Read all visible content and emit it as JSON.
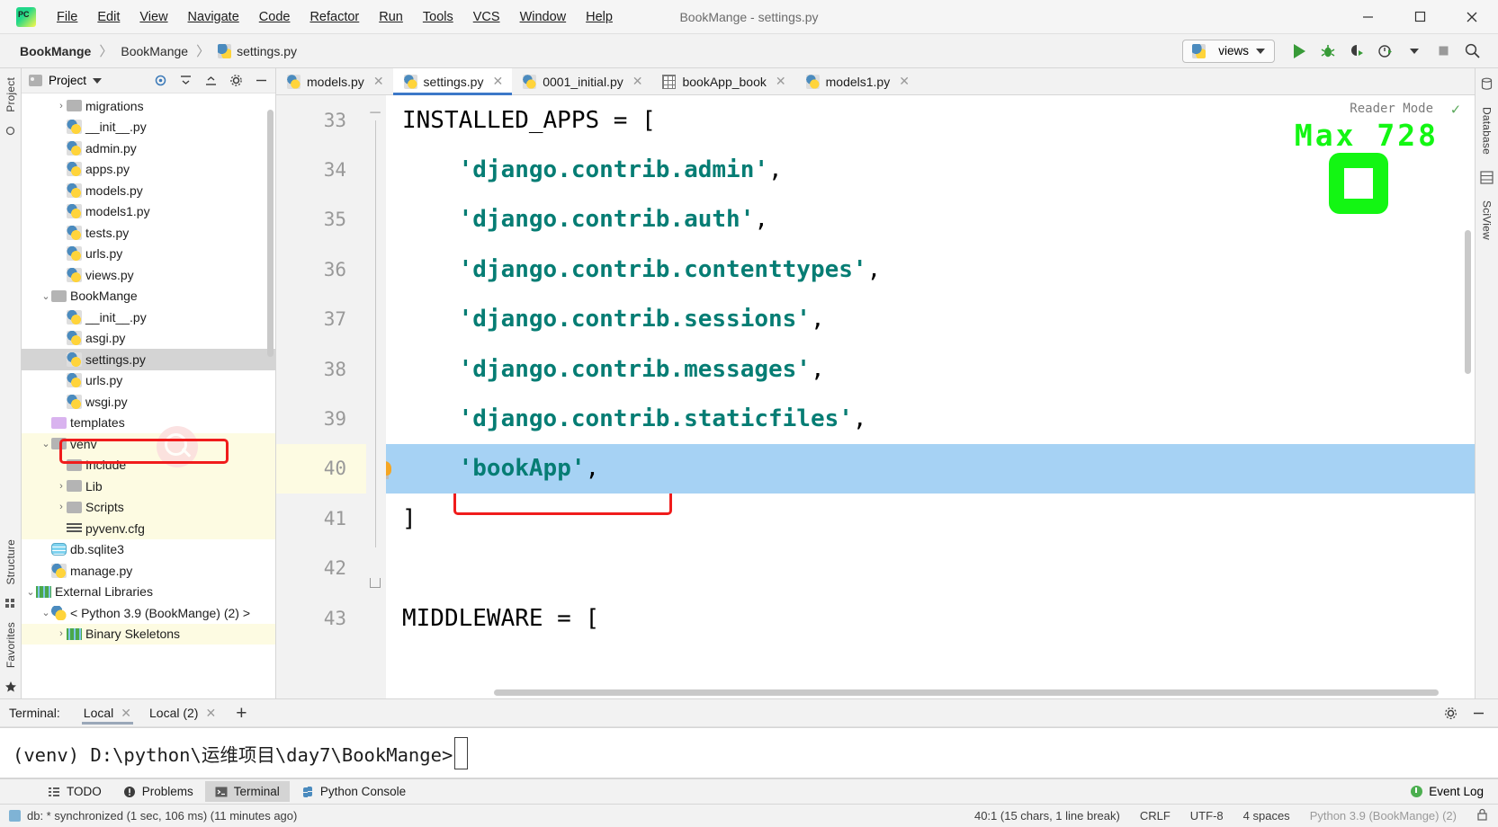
{
  "window": {
    "title": "BookMange - settings.py",
    "minimize": "—",
    "maximize": "☐",
    "close": "✕"
  },
  "menu": {
    "items": [
      "File",
      "Edit",
      "View",
      "Navigate",
      "Code",
      "Refactor",
      "Run",
      "Tools",
      "VCS",
      "Window",
      "Help"
    ]
  },
  "breadcrumb": {
    "project": "BookMange",
    "module": "BookMange",
    "file": "settings.py",
    "separator": "〉"
  },
  "toolbar": {
    "run_config": "views",
    "run_title": "Run",
    "debug_title": "Debug",
    "coverage_title": "Run with Coverage",
    "profile_title": "Profile",
    "stop_title": "Stop",
    "search_title": "Search Everywhere"
  },
  "project_panel": {
    "title": "Project",
    "tree": [
      {
        "label": "migrations",
        "indent": 2,
        "arrow": "›",
        "icon": "folder-icon",
        "selected": false,
        "venv": false
      },
      {
        "label": "__init__.py",
        "indent": 2,
        "arrow": "",
        "icon": "python-file-icon",
        "selected": false,
        "venv": false
      },
      {
        "label": "admin.py",
        "indent": 2,
        "arrow": "",
        "icon": "python-file-icon",
        "selected": false,
        "venv": false
      },
      {
        "label": "apps.py",
        "indent": 2,
        "arrow": "",
        "icon": "python-file-icon",
        "selected": false,
        "venv": false
      },
      {
        "label": "models.py",
        "indent": 2,
        "arrow": "",
        "icon": "python-file-icon",
        "selected": false,
        "venv": false
      },
      {
        "label": "models1.py",
        "indent": 2,
        "arrow": "",
        "icon": "python-file-icon",
        "selected": false,
        "venv": false
      },
      {
        "label": "tests.py",
        "indent": 2,
        "arrow": "",
        "icon": "python-file-icon",
        "selected": false,
        "venv": false
      },
      {
        "label": "urls.py",
        "indent": 2,
        "arrow": "",
        "icon": "python-file-icon",
        "selected": false,
        "venv": false
      },
      {
        "label": "views.py",
        "indent": 2,
        "arrow": "",
        "icon": "python-file-icon",
        "selected": false,
        "venv": false
      },
      {
        "label": "BookMange",
        "indent": 1,
        "arrow": "⌄",
        "icon": "folder-icon",
        "selected": false,
        "venv": false
      },
      {
        "label": "__init__.py",
        "indent": 2,
        "arrow": "",
        "icon": "python-file-icon",
        "selected": false,
        "venv": false
      },
      {
        "label": "asgi.py",
        "indent": 2,
        "arrow": "",
        "icon": "python-file-icon",
        "selected": false,
        "venv": false
      },
      {
        "label": "settings.py",
        "indent": 2,
        "arrow": "",
        "icon": "python-file-icon",
        "selected": true,
        "venv": false
      },
      {
        "label": "urls.py",
        "indent": 2,
        "arrow": "",
        "icon": "python-file-icon",
        "selected": false,
        "venv": false
      },
      {
        "label": "wsgi.py",
        "indent": 2,
        "arrow": "",
        "icon": "python-file-icon",
        "selected": false,
        "venv": false
      },
      {
        "label": "templates",
        "indent": 1,
        "arrow": "",
        "icon": "folder-purple-icon",
        "selected": false,
        "venv": false
      },
      {
        "label": "venv",
        "indent": 1,
        "arrow": "⌄",
        "icon": "folder-icon",
        "selected": false,
        "venv": true
      },
      {
        "label": "Include",
        "indent": 2,
        "arrow": "",
        "icon": "folder-icon",
        "selected": false,
        "venv": true
      },
      {
        "label": "Lib",
        "indent": 2,
        "arrow": "›",
        "icon": "folder-icon",
        "selected": false,
        "venv": true
      },
      {
        "label": "Scripts",
        "indent": 2,
        "arrow": "›",
        "icon": "folder-icon",
        "selected": false,
        "venv": true
      },
      {
        "label": "pyvenv.cfg",
        "indent": 2,
        "arrow": "",
        "icon": "config-file-icon",
        "selected": false,
        "venv": true
      },
      {
        "label": "db.sqlite3",
        "indent": 1,
        "arrow": "",
        "icon": "database-icon",
        "selected": false,
        "venv": false
      },
      {
        "label": "manage.py",
        "indent": 1,
        "arrow": "",
        "icon": "python-file-icon",
        "selected": false,
        "venv": false
      },
      {
        "label": "External Libraries",
        "indent": 0,
        "arrow": "⌄",
        "icon": "libraries-icon",
        "selected": false,
        "venv": false
      },
      {
        "label": "< Python 3.9 (BookMange) (2) >",
        "indent": 1,
        "arrow": "⌄",
        "icon": "python-interpreter-icon",
        "selected": false,
        "venv": false
      },
      {
        "label": "Binary Skeletons",
        "indent": 2,
        "arrow": "›",
        "icon": "libraries-icon",
        "selected": false,
        "venv": true
      }
    ]
  },
  "editor": {
    "tabs": [
      {
        "label": "models.py",
        "icon": "python-file-icon",
        "active": false
      },
      {
        "label": "settings.py",
        "icon": "python-file-icon",
        "active": true
      },
      {
        "label": "0001_initial.py",
        "icon": "python-file-icon",
        "active": false
      },
      {
        "label": "bookApp_book",
        "icon": "table-icon",
        "active": false
      },
      {
        "label": "models1.py",
        "icon": "python-file-icon",
        "active": false
      }
    ],
    "reader_mode": "Reader Mode",
    "overlay_text": "Max 728",
    "overlay_color": "#13f613",
    "lines": [
      {
        "num": "33",
        "segments": [
          {
            "t": "INSTALLED_APPS = [",
            "c": "kw"
          }
        ],
        "highlight": false,
        "bulb": false
      },
      {
        "num": "34",
        "segments": [
          {
            "t": "    ",
            "c": "pun"
          },
          {
            "t": "'django.contrib.admin'",
            "c": "str"
          },
          {
            "t": ",",
            "c": "pun"
          }
        ],
        "highlight": false,
        "bulb": false
      },
      {
        "num": "35",
        "segments": [
          {
            "t": "    ",
            "c": "pun"
          },
          {
            "t": "'django.contrib.auth'",
            "c": "str"
          },
          {
            "t": ",",
            "c": "pun"
          }
        ],
        "highlight": false,
        "bulb": false
      },
      {
        "num": "36",
        "segments": [
          {
            "t": "    ",
            "c": "pun"
          },
          {
            "t": "'django.contrib.contenttypes'",
            "c": "str"
          },
          {
            "t": ",",
            "c": "pun"
          }
        ],
        "highlight": false,
        "bulb": false
      },
      {
        "num": "37",
        "segments": [
          {
            "t": "    ",
            "c": "pun"
          },
          {
            "t": "'django.contrib.sessions'",
            "c": "str"
          },
          {
            "t": ",",
            "c": "pun"
          }
        ],
        "highlight": false,
        "bulb": false
      },
      {
        "num": "38",
        "segments": [
          {
            "t": "    ",
            "c": "pun"
          },
          {
            "t": "'django.contrib.messages'",
            "c": "str"
          },
          {
            "t": ",",
            "c": "pun"
          }
        ],
        "highlight": false,
        "bulb": false
      },
      {
        "num": "39",
        "segments": [
          {
            "t": "    ",
            "c": "pun"
          },
          {
            "t": "'django.contrib.staticfiles'",
            "c": "str"
          },
          {
            "t": ",",
            "c": "pun"
          }
        ],
        "highlight": false,
        "bulb": false
      },
      {
        "num": "40",
        "segments": [
          {
            "t": "    ",
            "c": "pun"
          },
          {
            "t": "'bookApp'",
            "c": "str"
          },
          {
            "t": ",",
            "c": "pun"
          }
        ],
        "highlight": true,
        "bulb": true
      },
      {
        "num": "41",
        "segments": [
          {
            "t": "]",
            "c": "kw"
          }
        ],
        "highlight": false,
        "bulb": false
      },
      {
        "num": "42",
        "segments": [
          {
            "t": "",
            "c": "pun"
          }
        ],
        "highlight": false,
        "bulb": false
      },
      {
        "num": "43",
        "segments": [
          {
            "t": "MIDDLEWARE = [",
            "c": "kw"
          }
        ],
        "highlight": false,
        "bulb": false
      }
    ]
  },
  "terminal": {
    "label": "Terminal:",
    "tabs": [
      {
        "label": "Local",
        "active": true
      },
      {
        "label": "Local (2)",
        "active": false
      }
    ],
    "add": "+",
    "prompt": "(venv) D:\\python\\运维项目\\day7\\BookMange>"
  },
  "bottom_tools": {
    "tabs": [
      {
        "label": "TODO",
        "icon": "todo-icon",
        "active": false
      },
      {
        "label": "Problems",
        "icon": "problems-icon",
        "active": false
      },
      {
        "label": "Terminal",
        "icon": "terminal-icon",
        "active": true
      },
      {
        "label": "Python Console",
        "icon": "python-icon",
        "active": false
      }
    ],
    "event_log": "Event Log"
  },
  "statusbar": {
    "message": "db: * synchronized (1 sec, 106 ms) (11 minutes ago)",
    "caret": "40:1 (15 chars, 1 line break)",
    "line_sep": "CRLF",
    "encoding": "UTF-8",
    "indent": "4 spaces",
    "interpreter": "Python 3.9 (BookMange) (2)"
  },
  "side_strips": {
    "left_top": "Project",
    "left_mid": "Structure",
    "left_bottom": "Favorites",
    "right_top": "Database",
    "right_mid": "SciView"
  }
}
